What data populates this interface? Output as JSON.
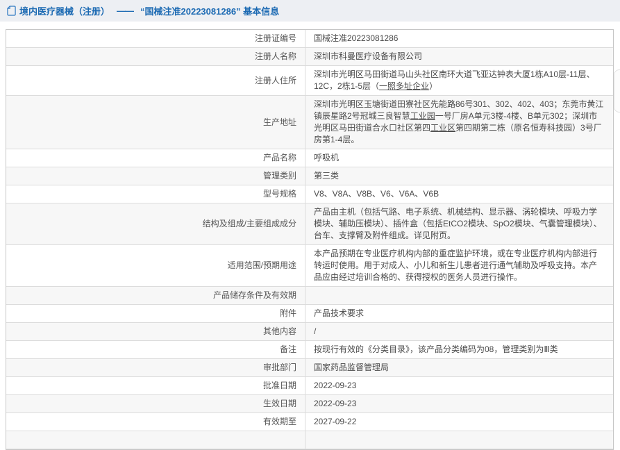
{
  "header": {
    "title_prefix": "境内医疗器械（注册）",
    "dash": "——",
    "title_main": "“国械注准20223081286” 基本信息",
    "accent_color": "#1c6ab3"
  },
  "table": {
    "rows": [
      {
        "label": "注册证编号",
        "parts": [
          {
            "t": "国械注准20223081286"
          }
        ]
      },
      {
        "label": "注册人名称",
        "parts": [
          {
            "t": "深圳市科曼医疗设备有限公司"
          }
        ]
      },
      {
        "label": "注册人住所",
        "parts": [
          {
            "t": "深圳市光明区马田街道马山头社区南环大道飞亚达钟表大厦1栋A10层-11层、12C，2栋1-5层（"
          },
          {
            "t": "一照多址企业",
            "u": true
          },
          {
            "t": "）"
          }
        ]
      },
      {
        "label": "生产地址",
        "parts": [
          {
            "t": "深圳市光明区玉塘街道田寮社区先能路86号301、302、402、403；东莞市黄江镇辰星路2号冠城三良智慧"
          },
          {
            "t": "工业园",
            "u": true
          },
          {
            "t": "一号厂房A单元3楼-4楼、B单元302；深圳市光明区马田街道合水口社区第四"
          },
          {
            "t": "工业区",
            "u": true
          },
          {
            "t": "第四期第二栋（原名恒寿科技园）3号厂房第1-4层。"
          }
        ]
      },
      {
        "label": "产品名称",
        "parts": [
          {
            "t": "呼吸机"
          }
        ]
      },
      {
        "label": "管理类别",
        "parts": [
          {
            "t": "第三类"
          }
        ]
      },
      {
        "label": "型号规格",
        "parts": [
          {
            "t": "V8、V8A、V8B、V6、V6A、V6B"
          }
        ]
      },
      {
        "label": "结构及组成/主要组成成分",
        "parts": [
          {
            "t": "产品由主机（包括气路、电子系统、机械结构、显示器、涡轮模块、呼吸力学模块、辅助压模块）、插件盒（包括EtCO2模块、SpO2模块、气囊管理模块）、台车、支撑臂及附件组成。详见附页。"
          }
        ]
      },
      {
        "label": "适用范围/预期用途",
        "parts": [
          {
            "t": "本产品预期在专业医疗机构内部的重症监护环境，或在专业医疗机构内部进行转运时使用。用于对成人、小儿和新生儿患者进行通气辅助及呼吸支持。本产品应由经过培训合格的、获得授权的医务人员进行操作。"
          }
        ]
      },
      {
        "label": "产品储存条件及有效期",
        "parts": [
          {
            "t": ""
          }
        ]
      },
      {
        "label": "附件",
        "parts": [
          {
            "t": "产品技术要求"
          }
        ]
      },
      {
        "label": "其他内容",
        "parts": [
          {
            "t": "/"
          }
        ]
      },
      {
        "label": "备注",
        "parts": [
          {
            "t": "按现行有效的《分类目录》，该产品分类编码为08，管理类别为Ⅲ类"
          }
        ]
      },
      {
        "label": "审批部门",
        "parts": [
          {
            "t": "国家药品监督管理局"
          }
        ]
      },
      {
        "label": "批准日期",
        "parts": [
          {
            "t": "2022-09-23"
          }
        ]
      },
      {
        "label": "生效日期",
        "parts": [
          {
            "t": "2022-09-23"
          }
        ]
      },
      {
        "label": "有效期至",
        "parts": [
          {
            "t": "2027-09-22"
          }
        ]
      },
      {
        "label": "",
        "parts": [
          {
            "t": ""
          }
        ]
      }
    ]
  }
}
